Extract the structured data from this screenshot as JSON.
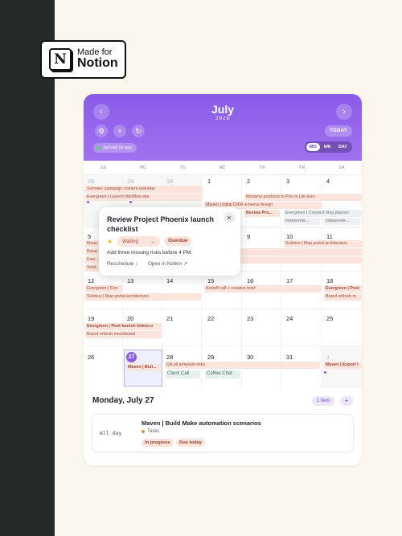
{
  "badge": {
    "line1": "Made for",
    "line2": "Notion",
    "logo_letter": "N"
  },
  "header": {
    "month": "July",
    "year": "2026",
    "prev_icon": "chevron-left",
    "next_icon": "chevron-right",
    "today_label": "TODAY",
    "synced_label": "Synced 9s ago",
    "views": [
      "MO",
      "WK",
      "DAY"
    ],
    "active_view": "MO",
    "accent": "#8a5be8"
  },
  "weekdays": [
    "SU",
    "MO",
    "TU",
    "WE",
    "TH",
    "FR",
    "SA"
  ],
  "days": {
    "w1": [
      "28",
      "29",
      "30",
      "1",
      "2",
      "3",
      "4"
    ],
    "w2": [
      "5",
      "",
      "",
      "",
      "9",
      "10",
      "11"
    ],
    "w3": [
      "12",
      "13",
      "14",
      "15",
      "16",
      "17",
      "18"
    ],
    "w4": [
      "19",
      "20",
      "21",
      "22",
      "23",
      "24",
      "25"
    ],
    "w5": [
      "26",
      "27",
      "28",
      "29",
      "30",
      "31",
      "1"
    ]
  },
  "events": {
    "summer_campaign": "Summer campaign content calendar",
    "launch_webflow": "Evergreen | Launch Webflow site",
    "crm_schema": "Maven | Initial CRM schema design",
    "rename_products": "Rename products to Pro vs Lite tiers",
    "review_pro": "Review Pro...",
    "connect_blog": "Evergreen | Connect blog planner",
    "indep1": "Independe...",
    "indep2": "Independe...",
    "w2_mave": "Mave",
    "w2_rena": "Rena",
    "w2_ever": "Ever",
    "w2_sols": "Solst",
    "solstice_map_w2": "Solstice | Map portal architecture",
    "evergreen_con": "Evergreen | Con",
    "solstice_map_w3": "Solstice | Map portal architecture",
    "kickoff": "Kickoff call + creative brief",
    "evergreen_post": "Evergreen | Post",
    "brand_refresh_w3": "Brand refresh m",
    "post_launch": "Evergreen | Post-launch follow-u",
    "brand_refresh_w4": "Brand refresh moodboard",
    "maven_build_short": "Maven | Buil...",
    "qa_template": "QA all template links",
    "client_call": "Client Call",
    "coffee_chat": "Coffee Chat",
    "maven_export": "Maven | Export l"
  },
  "popover": {
    "title": "Review Project Phoenix launch checklist",
    "status": "Waiting",
    "overdue": "Overdue",
    "note": "Add three missing risks before 4 PM.",
    "reschedule": "Reschedule ↓",
    "open_notion": "Open in Notion ↗"
  },
  "agenda": {
    "date_title": "Monday, July 27",
    "count_label": "1 item",
    "add_label": "+",
    "allday": "All day",
    "item_title": "Maven | Build Make automation scenarios",
    "item_source": "Tasks",
    "tags": [
      "In progress",
      "Due today"
    ]
  }
}
